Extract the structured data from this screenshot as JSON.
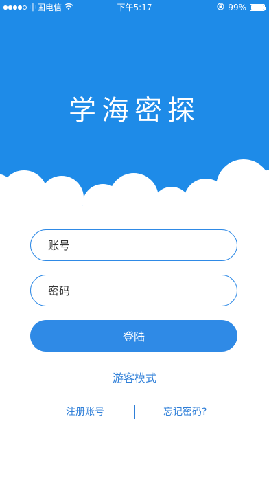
{
  "status_bar": {
    "carrier": "中国电信",
    "time": "下午5:17",
    "battery": "99%",
    "battery_level": 0.99,
    "wifi_icon": "wifi-icon",
    "lock_icon": "rotation-lock-icon"
  },
  "app": {
    "title": "学海密探"
  },
  "login": {
    "account_placeholder": "账号",
    "password_placeholder": "密码",
    "login_label": "登陆",
    "guest_label": "游客模式",
    "register_label": "注册账号",
    "forgot_label": "忘记密码?"
  },
  "colors": {
    "brand": "#1e8be8",
    "accent": "#2f8ae6",
    "link": "#2f7fd8",
    "background": "#ffffff"
  }
}
